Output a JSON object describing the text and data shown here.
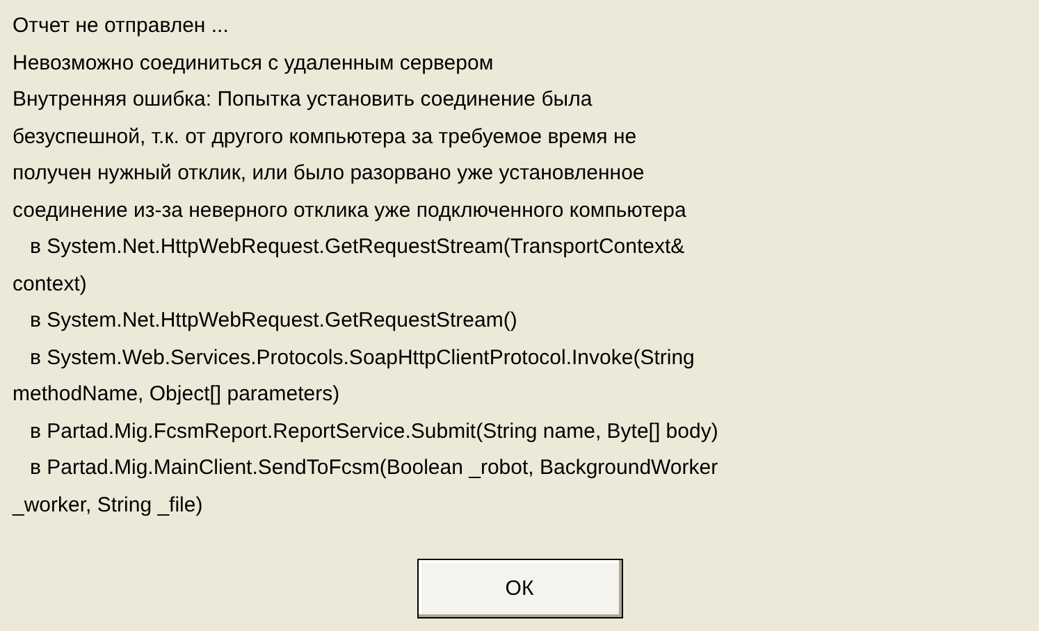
{
  "message_lines": [
    "Отчет не отправлен ...",
    "Невозможно соединиться с удаленным сервером",
    "Внутренняя ошибка: Попытка установить соединение была",
    "безуспешной, т.к. от другого компьютера за требуемое время не",
    "получен нужный отклик, или было разорвано уже установленное",
    "соединение из-за неверного отклика уже подключенного компьютера",
    "   в System.Net.HttpWebRequest.GetRequestStream(TransportContext&",
    "context)",
    "   в System.Net.HttpWebRequest.GetRequestStream()",
    "   в System.Web.Services.Protocols.SoapHttpClientProtocol.Invoke(String",
    "methodName, Object[] parameters)",
    "   в Partad.Mig.FcsmReport.ReportService.Submit(String name, Byte[] body)",
    "   в Partad.Mig.MainClient.SendToFcsm(Boolean _robot, BackgroundWorker",
    "_worker, String _file)"
  ],
  "buttons": [
    "ОК"
  ]
}
